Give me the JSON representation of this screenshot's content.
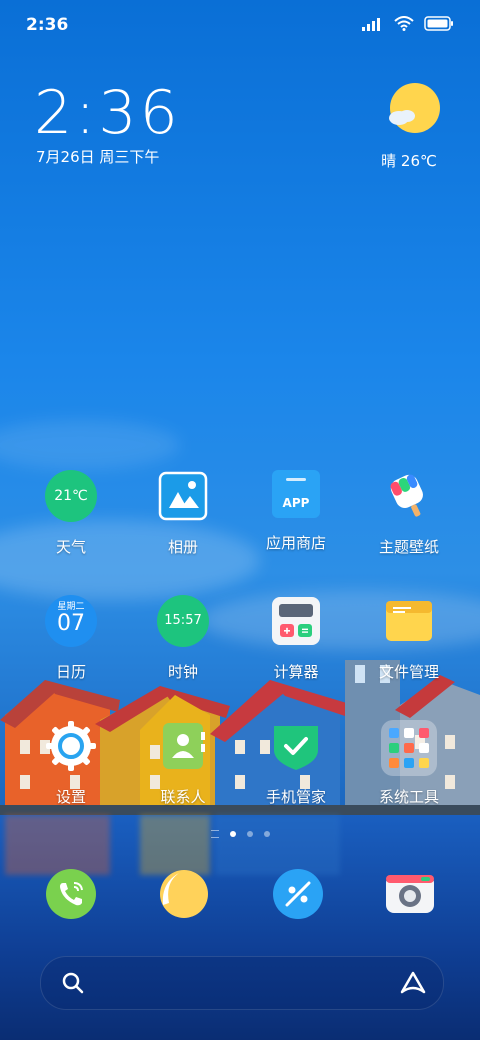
{
  "status_bar": {
    "time": "2:36"
  },
  "clock_widget": {
    "time": "2:36",
    "date": "7月26日 周三下午",
    "weather": "晴 26℃"
  },
  "apps": {
    "row1": [
      {
        "label": "天气",
        "icon_text": "21℃"
      },
      {
        "label": "相册"
      },
      {
        "label": "应用商店",
        "icon_text": "APP"
      },
      {
        "label": "主题壁纸"
      }
    ],
    "row2": [
      {
        "label": "日历",
        "icon_text_top": "星期二",
        "icon_text": "07"
      },
      {
        "label": "时钟",
        "icon_text": "15:57"
      },
      {
        "label": "计算器"
      },
      {
        "label": "文件管理"
      }
    ],
    "row3": [
      {
        "label": "设置"
      },
      {
        "label": "联系人"
      },
      {
        "label": "手机管家"
      },
      {
        "label": "系统工具"
      }
    ]
  },
  "dock": [
    "phone-icon",
    "messages-icon",
    "browser-icon",
    "camera-icon"
  ],
  "colors": {
    "weather_green": "#1dc47e",
    "calendar_blue": "#1f8ff0",
    "store_blue": "#2aa3f5",
    "security_green": "#1fc57c",
    "phone_green": "#7ad14e",
    "sun_yellow": "#ffd54d"
  }
}
